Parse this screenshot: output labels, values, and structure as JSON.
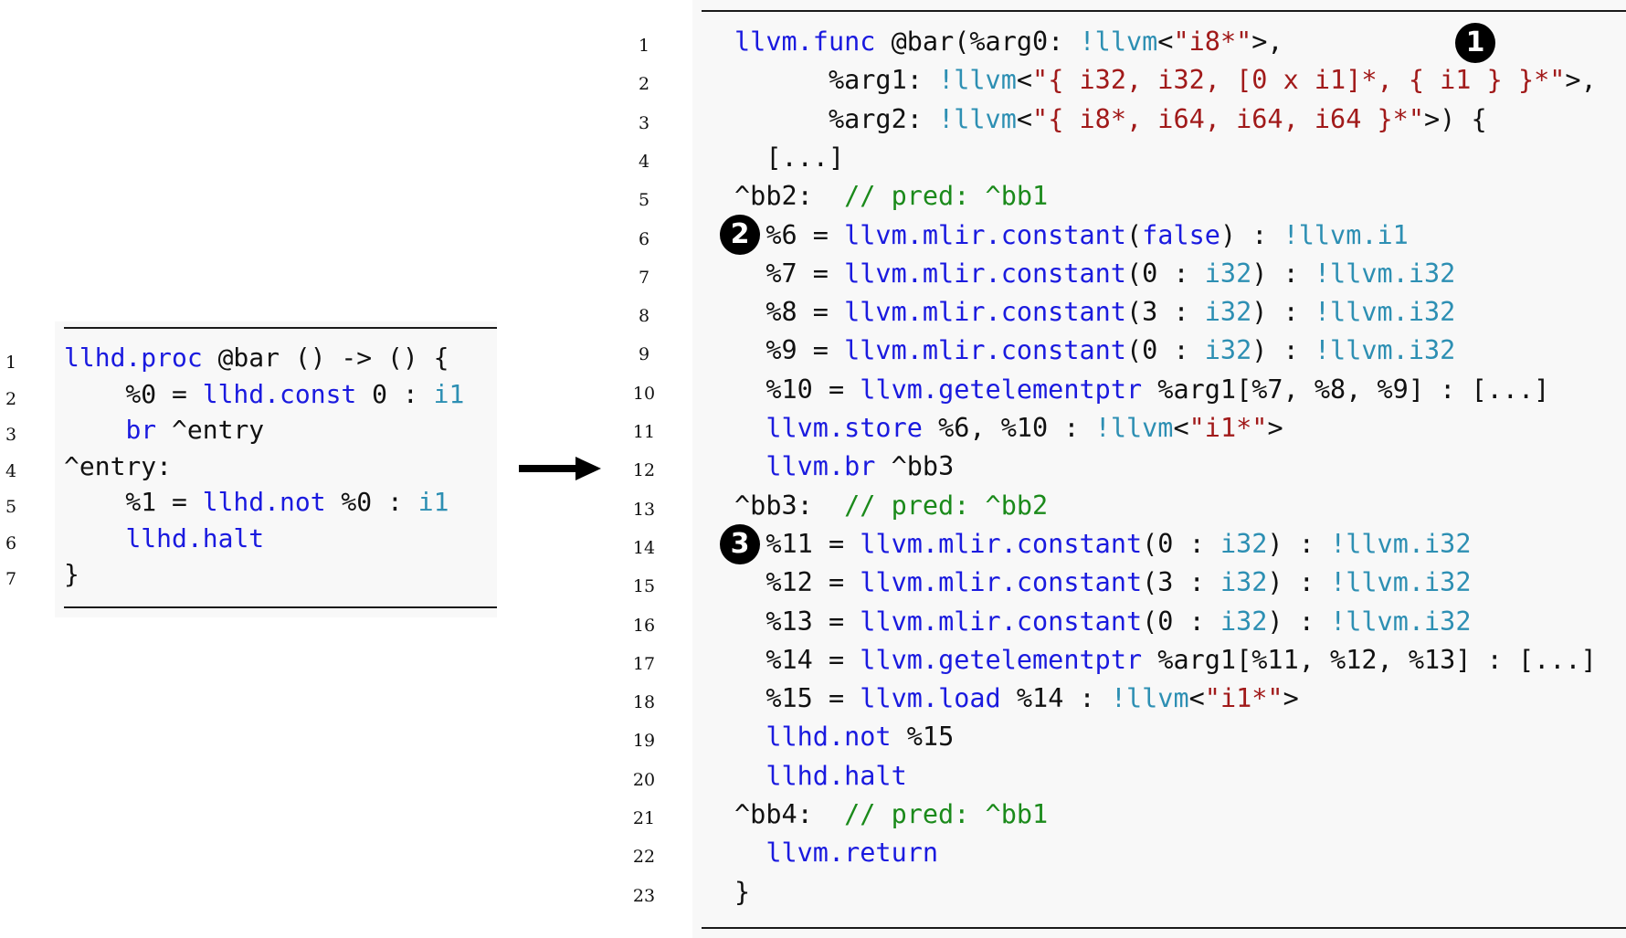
{
  "left_listing": {
    "line_numbers": [
      "1",
      "2",
      "3",
      "4",
      "5",
      "6",
      "7"
    ],
    "lines": [
      [
        [
          "kw",
          "llhd.proc"
        ],
        [
          "txt",
          " @bar () -> () {"
        ]
      ],
      [
        [
          "txt",
          "    %0 = "
        ],
        [
          "kw",
          "llhd.const"
        ],
        [
          "txt",
          " 0 : "
        ],
        [
          "type",
          "i1"
        ]
      ],
      [
        [
          "txt",
          "    "
        ],
        [
          "kw",
          "br"
        ],
        [
          "txt",
          " ^entry"
        ]
      ],
      [
        [
          "txt",
          "^entry:"
        ]
      ],
      [
        [
          "txt",
          "    %1 = "
        ],
        [
          "kw",
          "llhd.not"
        ],
        [
          "txt",
          " %0 : "
        ],
        [
          "type",
          "i1"
        ]
      ],
      [
        [
          "txt",
          "    "
        ],
        [
          "kw",
          "llhd.halt"
        ]
      ],
      [
        [
          "txt",
          "}"
        ]
      ]
    ]
  },
  "right_listing": {
    "line_numbers": [
      "1",
      "2",
      "3",
      "4",
      "5",
      "6",
      "7",
      "8",
      "9",
      "10",
      "11",
      "12",
      "13",
      "14",
      "15",
      "16",
      "17",
      "18",
      "19",
      "20",
      "21",
      "22",
      "23"
    ],
    "lines": [
      [
        [
          "kw",
          "llvm.func"
        ],
        [
          "txt",
          " @bar(%arg0: "
        ],
        [
          "type",
          "!llvm"
        ],
        [
          "txt",
          "<"
        ],
        [
          "str",
          "\"i8*\""
        ],
        [
          "txt",
          ">,"
        ]
      ],
      [
        [
          "txt",
          "      %arg1: "
        ],
        [
          "type",
          "!llvm"
        ],
        [
          "txt",
          "<"
        ],
        [
          "str",
          "\"{ i32, i32, [0 x i1]*, { i1 } }*\""
        ],
        [
          "txt",
          ">,"
        ]
      ],
      [
        [
          "txt",
          "      %arg2: "
        ],
        [
          "type",
          "!llvm"
        ],
        [
          "txt",
          "<"
        ],
        [
          "str",
          "\"{ i8*, i64, i64, i64 }*\""
        ],
        [
          "txt",
          ">) {"
        ]
      ],
      [
        [
          "txt",
          "  [...]"
        ]
      ],
      [
        [
          "txt",
          "^bb2:  "
        ],
        [
          "cmt",
          "// pred: ^bb1"
        ]
      ],
      [
        [
          "txt",
          "  %6 = "
        ],
        [
          "kw",
          "llvm.mlir.constant"
        ],
        [
          "txt",
          "("
        ],
        [
          "kw",
          "false"
        ],
        [
          "txt",
          ") : "
        ],
        [
          "type",
          "!llvm.i1"
        ]
      ],
      [
        [
          "txt",
          "  %7 = "
        ],
        [
          "kw",
          "llvm.mlir.constant"
        ],
        [
          "txt",
          "(0 : "
        ],
        [
          "type",
          "i32"
        ],
        [
          "txt",
          ") : "
        ],
        [
          "type",
          "!llvm.i32"
        ]
      ],
      [
        [
          "txt",
          "  %8 = "
        ],
        [
          "kw",
          "llvm.mlir.constant"
        ],
        [
          "txt",
          "(3 : "
        ],
        [
          "type",
          "i32"
        ],
        [
          "txt",
          ") : "
        ],
        [
          "type",
          "!llvm.i32"
        ]
      ],
      [
        [
          "txt",
          "  %9 = "
        ],
        [
          "kw",
          "llvm.mlir.constant"
        ],
        [
          "txt",
          "(0 : "
        ],
        [
          "type",
          "i32"
        ],
        [
          "txt",
          ") : "
        ],
        [
          "type",
          "!llvm.i32"
        ]
      ],
      [
        [
          "txt",
          "  %10 = "
        ],
        [
          "kw",
          "llvm.getelementptr"
        ],
        [
          "txt",
          " %arg1[%7, %8, %9] : [...]"
        ]
      ],
      [
        [
          "txt",
          "  "
        ],
        [
          "kw",
          "llvm.store"
        ],
        [
          "txt",
          " %6, %10 : "
        ],
        [
          "type",
          "!llvm"
        ],
        [
          "txt",
          "<"
        ],
        [
          "str",
          "\"i1*\""
        ],
        [
          "txt",
          ">"
        ]
      ],
      [
        [
          "txt",
          "  "
        ],
        [
          "kw",
          "llvm.br"
        ],
        [
          "txt",
          " ^bb3"
        ]
      ],
      [
        [
          "txt",
          "^bb3:  "
        ],
        [
          "cmt",
          "// pred: ^bb2"
        ]
      ],
      [
        [
          "txt",
          "  %11 = "
        ],
        [
          "kw",
          "llvm.mlir.constant"
        ],
        [
          "txt",
          "(0 : "
        ],
        [
          "type",
          "i32"
        ],
        [
          "txt",
          ") : "
        ],
        [
          "type",
          "!llvm.i32"
        ]
      ],
      [
        [
          "txt",
          "  %12 = "
        ],
        [
          "kw",
          "llvm.mlir.constant"
        ],
        [
          "txt",
          "(3 : "
        ],
        [
          "type",
          "i32"
        ],
        [
          "txt",
          ") : "
        ],
        [
          "type",
          "!llvm.i32"
        ]
      ],
      [
        [
          "txt",
          "  %13 = "
        ],
        [
          "kw",
          "llvm.mlir.constant"
        ],
        [
          "txt",
          "(0 : "
        ],
        [
          "type",
          "i32"
        ],
        [
          "txt",
          ") : "
        ],
        [
          "type",
          "!llvm.i32"
        ]
      ],
      [
        [
          "txt",
          "  %14 = "
        ],
        [
          "kw",
          "llvm.getelementptr"
        ],
        [
          "txt",
          " %arg1[%11, %12, %13] : [...]"
        ]
      ],
      [
        [
          "txt",
          "  %15 = "
        ],
        [
          "kw",
          "llvm.load"
        ],
        [
          "txt",
          " %14 : "
        ],
        [
          "type",
          "!llvm"
        ],
        [
          "txt",
          "<"
        ],
        [
          "str",
          "\"i1*\""
        ],
        [
          "txt",
          ">"
        ]
      ],
      [
        [
          "txt",
          "  "
        ],
        [
          "kw",
          "llhd.not"
        ],
        [
          "txt",
          " %15"
        ]
      ],
      [
        [
          "txt",
          "  "
        ],
        [
          "kw",
          "llhd.halt"
        ]
      ],
      [
        [
          "txt",
          "^bb4:  "
        ],
        [
          "cmt",
          "// pred: ^bb1"
        ]
      ],
      [
        [
          "txt",
          "  "
        ],
        [
          "kw",
          "llvm.return"
        ]
      ],
      [
        [
          "txt",
          "}"
        ]
      ]
    ]
  },
  "badges": [
    {
      "label": "1",
      "name": "badge-1"
    },
    {
      "label": "2",
      "name": "badge-2"
    },
    {
      "label": "3",
      "name": "badge-3"
    }
  ],
  "colors": {
    "keyword": "#1a1adf",
    "type": "#2d8fb3",
    "string": "#a11a1a",
    "comment": "#1b8a1b",
    "text": "#111111"
  },
  "icons": {
    "transform_arrow": "right-arrow-icon"
  }
}
